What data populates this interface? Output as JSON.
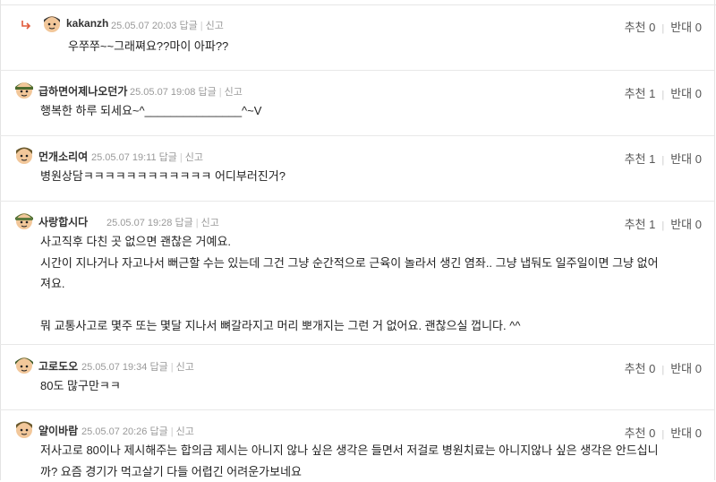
{
  "labels": {
    "reply": "답글",
    "report": "신고",
    "up": "추천",
    "down": "반대"
  },
  "comments": [
    {
      "nick": "kakanzh",
      "datetime": "25.05.07 20:03",
      "up": "0",
      "down": "0",
      "text": "우쭈쭈~~그래쪄요??마이 아파??",
      "is_reply": true
    },
    {
      "nick": "급하면어제나오던가",
      "datetime": "25.05.07 19:08",
      "up": "1",
      "down": "0",
      "text": "행복한 하루 되세요~^_______________^~V"
    },
    {
      "nick": "먼개소리여",
      "datetime": "25.05.07 19:11",
      "up": "1",
      "down": "0",
      "text": "병원상담ㅋㅋㅋㅋㅋㅋㅋㅋㅋㅋㅋㅋ 어디부러진거?"
    },
    {
      "nick": "사랑합시다",
      "datetime": "25.05.07 19:28",
      "up": "1",
      "down": "0",
      "text": "사고직후 다친 곳 없으면 괜찮은 거예요.\n시간이 지나거나 자고나서 뻐근할 수는 있는데 그건 그냥 순간적으로 근육이 놀라서 생긴 염좌.. 그냥 냅둬도 일주일이면 그냥 없어\n져요.\n\n뭐 교통사고로 몇주 또는 몇달 지나서 뼈갈라지고 머리 뽀개지는 그런 거 없어요. 괜찮으실 껍니다. ^^"
    },
    {
      "nick": "고로도오",
      "datetime": "25.05.07 19:34",
      "up": "0",
      "down": "0",
      "text": "80도 많구만ㅋㅋ"
    },
    {
      "nick": "얄이바람",
      "datetime": "25.05.07 20:26",
      "up": "0",
      "down": "0",
      "text": "저사고로 80이나 제시해주는 합의금 제시는 아니지 않나 싶은 생각은 들면서 저걸로 병원치료는 아니지않나 싶은 생각은 안드십니\n까? 요즘 경기가 먹고살기 다들 어렵긴 어려운가보네요"
    }
  ],
  "avatar_colors": {
    "skin": "#f2c79a",
    "hair": "#3a3a3a",
    "helmet": "#4c6b2e",
    "cap": "#6b6b6b"
  }
}
